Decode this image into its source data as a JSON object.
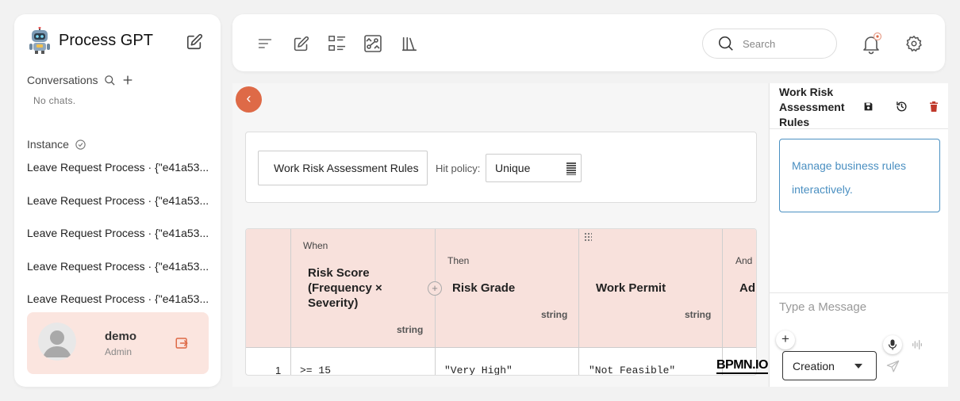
{
  "app": {
    "title": "Process GPT",
    "icons": {
      "logo": "robot-logo",
      "new_chat": "pencil-square-icon"
    }
  },
  "sidebar": {
    "conversations_label": "Conversations",
    "no_chats": "No chats.",
    "instance_label": "Instance",
    "instances": [
      "Leave Request Process · {\"e41a53...",
      "Leave Request Process · {\"e41a53...",
      "Leave Request Process · {\"e41a53...",
      "Leave Request Process · {\"e41a53...",
      "Leave Request Process · {\"e41a53..."
    ]
  },
  "user": {
    "name": "demo",
    "role": "Admin"
  },
  "topbar": {
    "icons": [
      "menu-lines-icon",
      "edit-icon",
      "checklist-icon",
      "diagram-icon",
      "library-icon"
    ],
    "search_placeholder": "Search"
  },
  "editor": {
    "back_glyph": "‹",
    "rule_name": "Work Risk Assessment Rules",
    "hit_policy_label": "Hit policy:",
    "hit_policy_value": "Unique",
    "columns": [
      {
        "clause": "When",
        "title": "Risk Score (Frequency × Severity)",
        "type": "string"
      },
      {
        "clause": "Then",
        "title": "Risk Grade",
        "type": "string"
      },
      {
        "clause": "",
        "title": "Work Permit",
        "type": "string"
      },
      {
        "clause": "And",
        "title": "Ad",
        "type": ""
      }
    ],
    "rows": [
      {
        "index": "1",
        "cells": [
          ">= 15",
          "\"Very High\"",
          "\"Not Feasible\""
        ]
      }
    ],
    "watermark": "BPMN.IO"
  },
  "right_panel": {
    "title": "Work Risk Assessment Rules",
    "message": "Manage business rules interactively.",
    "input_placeholder": "Type a Message",
    "mode": "Creation",
    "colors": {
      "accent": "#4a8fc1",
      "delete": "#c0392b"
    }
  },
  "colors": {
    "back_button": "#de6a47",
    "table_header": "#f8e1dc",
    "user_card": "#fbe5df"
  }
}
